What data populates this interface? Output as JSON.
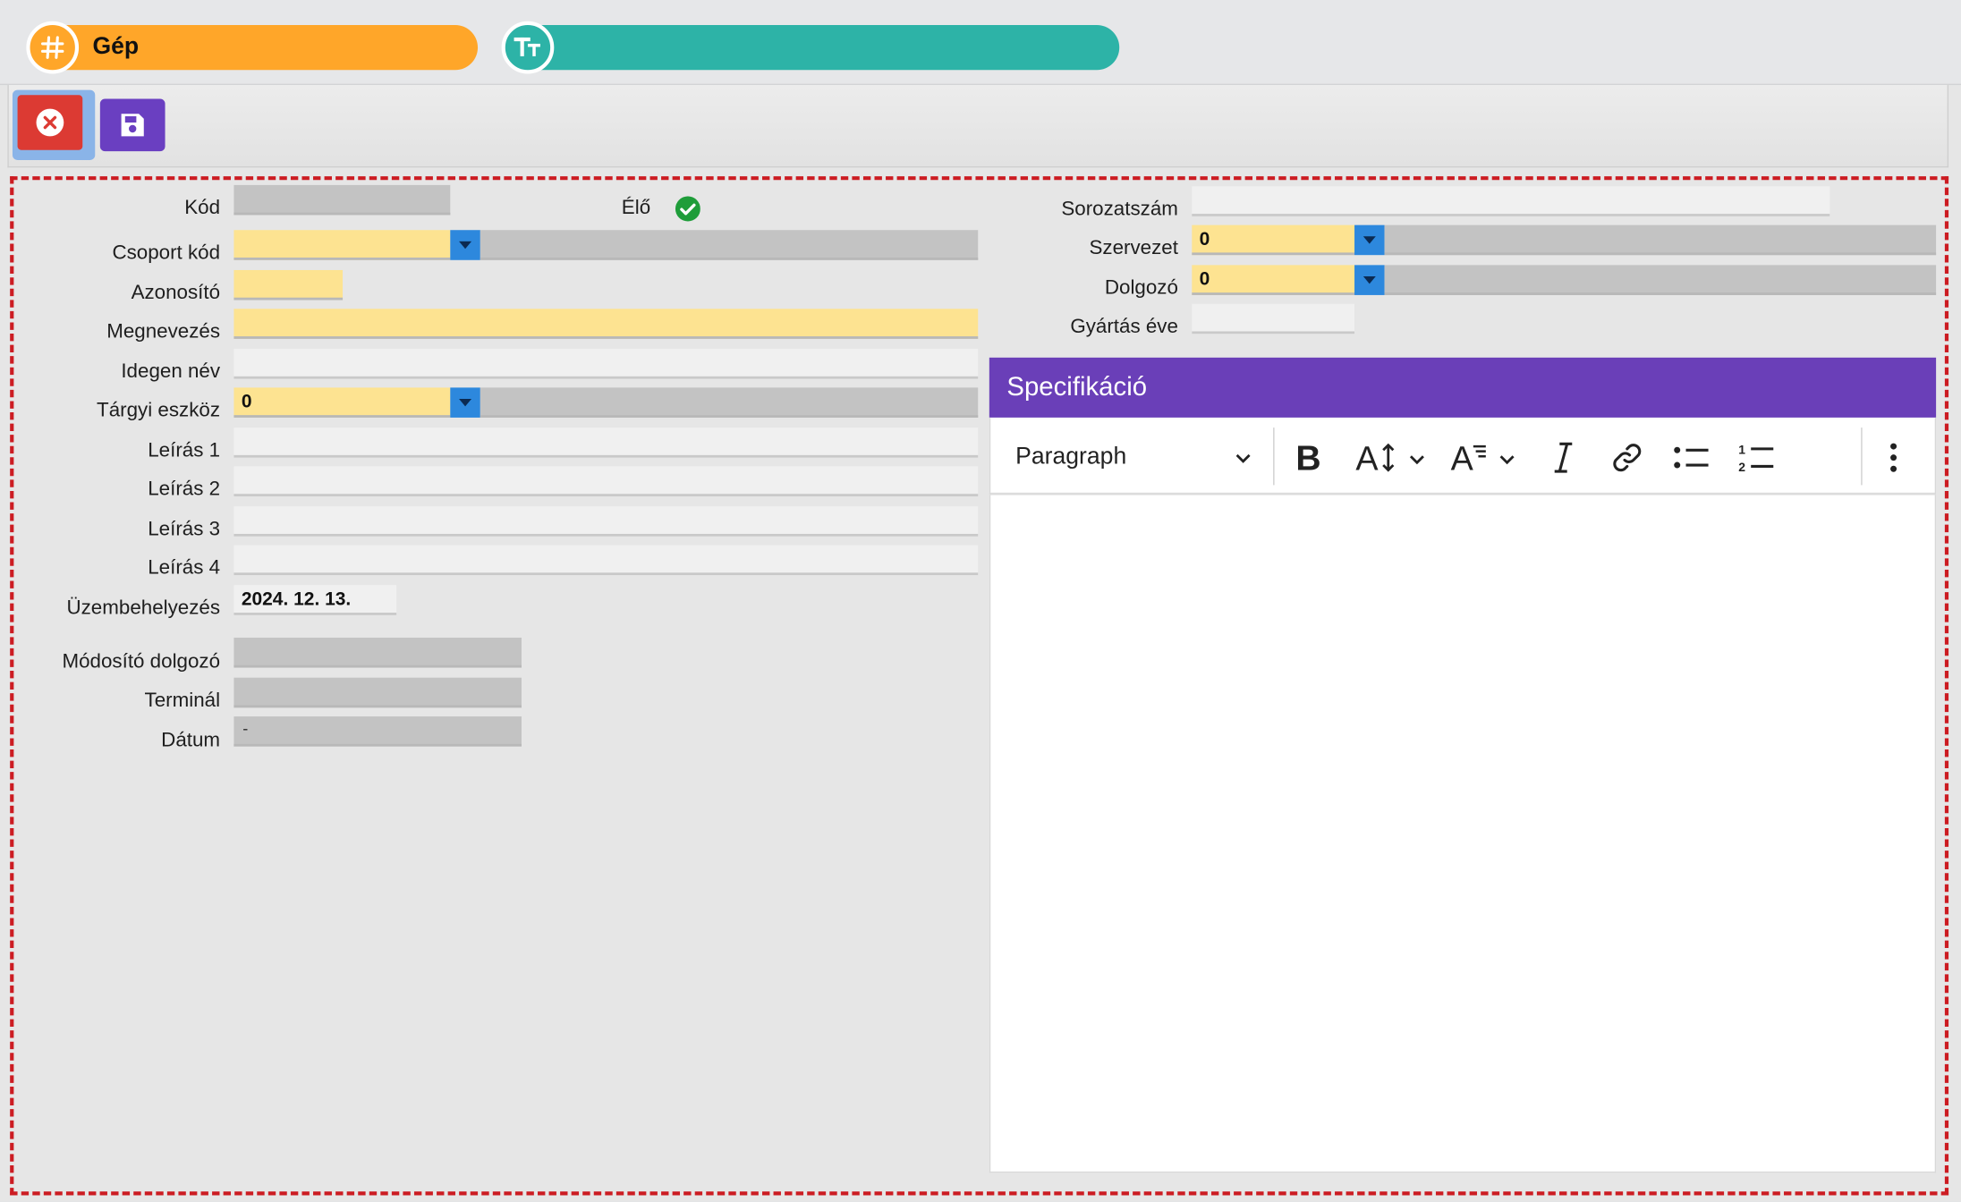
{
  "tabs": [
    {
      "label": "Gép",
      "icon": "hash-icon",
      "color": "#ffa629"
    },
    {
      "label": "",
      "icon": "text-type-icon",
      "color": "#2db3a7"
    }
  ],
  "toolbar": {
    "close_icon": "close-circle-icon",
    "save_icon": "floppy-disk-icon"
  },
  "form": {
    "kod_label": "Kód",
    "elo_label": "Élő",
    "csoport_label": "Csoport kód",
    "azonosito_label": "Azonosító",
    "megnevezes_label": "Megnevezés",
    "idegen_label": "Idegen név",
    "targyi_label": "Tárgyi eszköz",
    "targyi_value": "0",
    "leiras1_label": "Leírás 1",
    "leiras2_label": "Leírás 2",
    "leiras3_label": "Leírás 3",
    "leiras4_label": "Leírás 4",
    "uzembe_label": "Üzembehelyezés",
    "uzembe_value": "2024. 12. 13.",
    "modosito_label": "Módosító dolgozó",
    "terminal_label": "Terminál",
    "datum_label": "Dátum",
    "datum_value": "-",
    "sorozat_label": "Sorozatszám",
    "szervezet_label": "Szervezet",
    "szervezet_value": "0",
    "dolgozo_label": "Dolgozó",
    "dolgozo_value": "0",
    "gyartas_label": "Gyártás éve"
  },
  "spec": {
    "title": "Specifikáció",
    "paragraph_label": "Paragraph"
  },
  "colors": {
    "accent_purple": "#6a3fb8",
    "danger": "#dc3a33",
    "dropdown_blue": "#2d88dd",
    "required_yellow": "#fde391"
  }
}
